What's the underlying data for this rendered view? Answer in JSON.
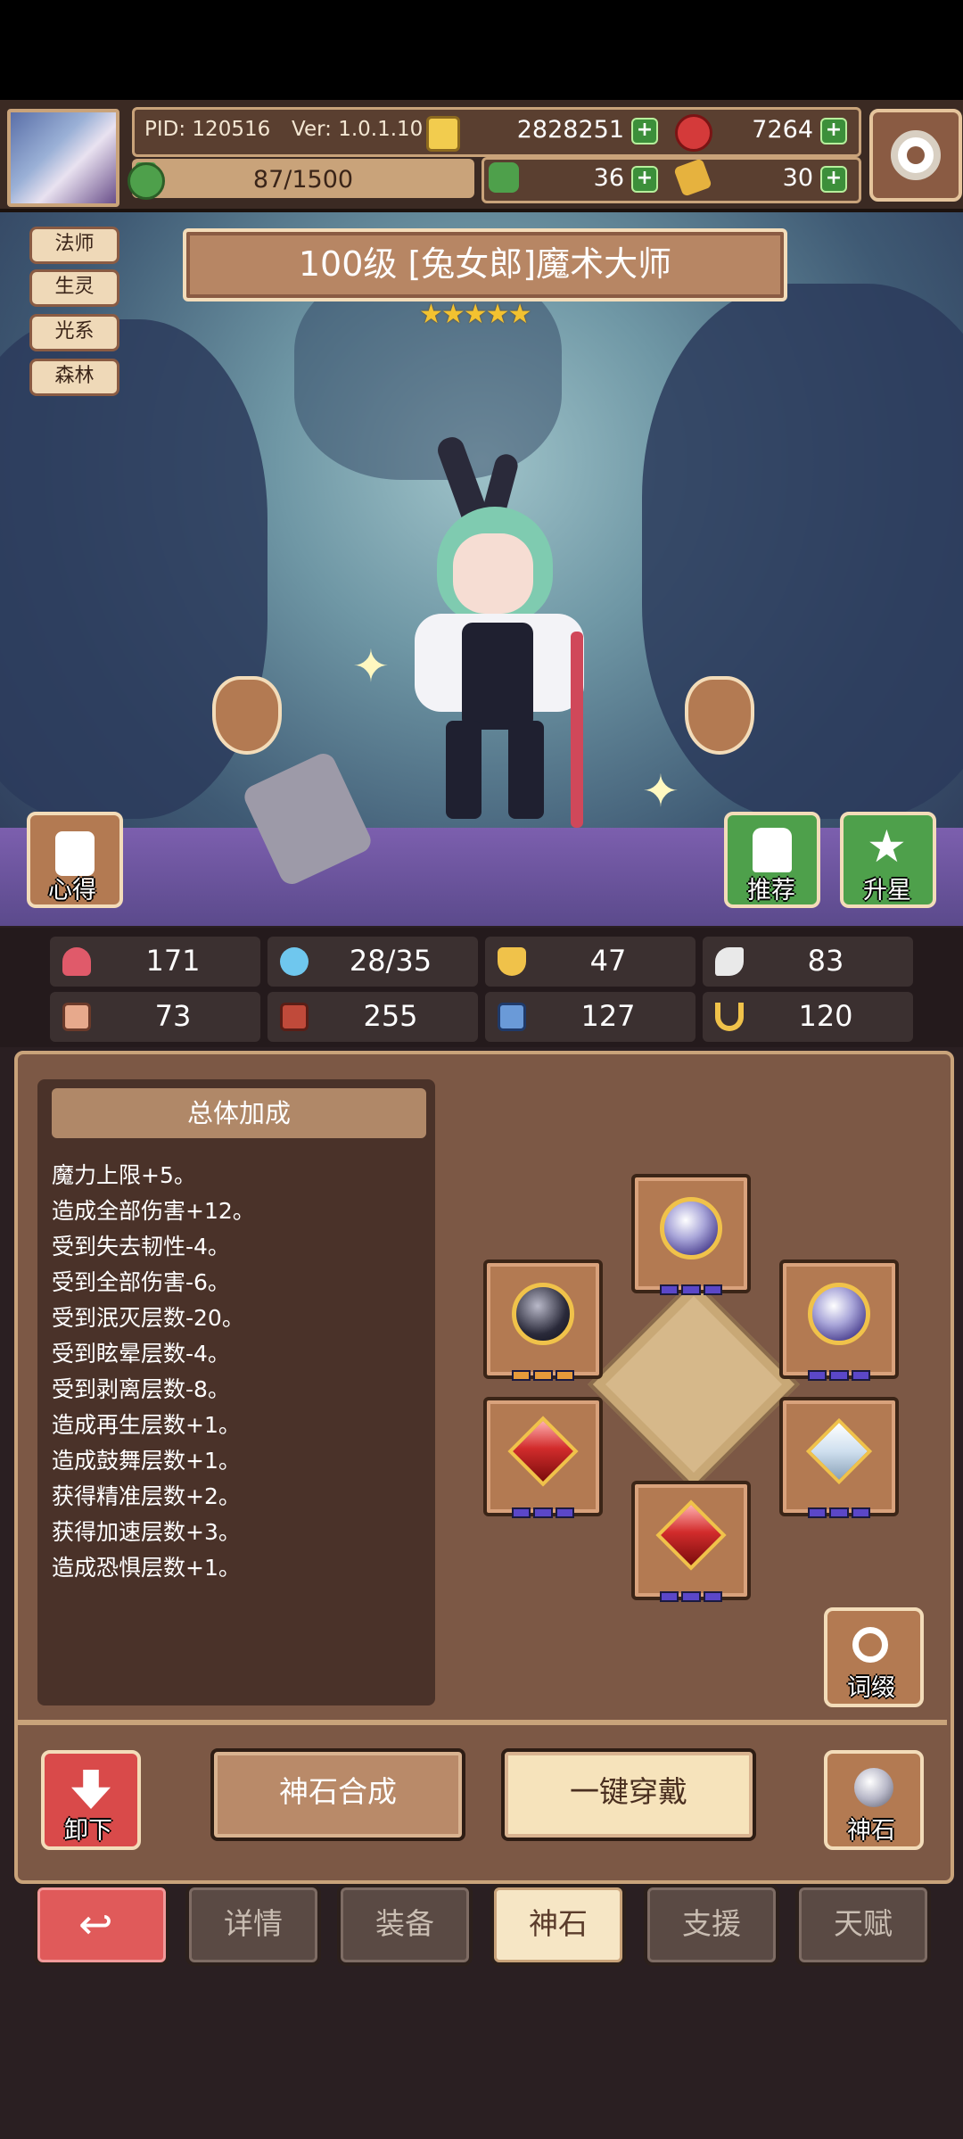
{
  "header": {
    "pid_label": "PID: 120516",
    "ver_label": "Ver: 1.0.1.10",
    "gold": "2828251",
    "ruby": "7264",
    "stamina": "87/1500",
    "clover": "36",
    "ticket": "30",
    "gear_icon": "gear-icon"
  },
  "tags": [
    "法师",
    "生灵",
    "光系",
    "森林"
  ],
  "character": {
    "title": "100级 [兔女郎]魔术大师",
    "stars": "★★★★★",
    "star_count": 5
  },
  "scene_buttons": {
    "notes": "心得",
    "recommend": "推荐",
    "star_up": "升星"
  },
  "stats": [
    {
      "icon": "heart-icon",
      "value": "171",
      "color": "#e05a6a"
    },
    {
      "icon": "mana-drop-icon",
      "value": "28/35",
      "color": "#6fc7ee"
    },
    {
      "icon": "shield-icon",
      "value": "47",
      "color": "#f0c24a"
    },
    {
      "icon": "wing-icon",
      "value": "83",
      "color": "#e9e9e9"
    },
    {
      "icon": "fist-icon",
      "value": "73",
      "color": "#e7a98c"
    },
    {
      "icon": "spellbook-icon",
      "value": "255",
      "color": "#c04a3a"
    },
    {
      "icon": "boot-icon",
      "value": "127",
      "color": "#6a9ad8"
    },
    {
      "icon": "horseshoe-icon",
      "value": "120",
      "color": "#f0c24a"
    }
  ],
  "bonus": {
    "title": "总体加成",
    "lines": [
      "魔力上限+5。",
      "造成全部伤害+12。",
      "受到失去韧性-4。",
      "受到全部伤害-6。",
      "受到泯灭层数-20。",
      "受到眩晕层数-4。",
      "受到剥离层数-8。",
      "造成再生层数+1。",
      "造成鼓舞层数+1。",
      "获得精准层数+2。",
      "获得加速层数+3。",
      "造成恐惧层数+1。"
    ]
  },
  "gem_slots": [
    {
      "name": "gem-slot-top",
      "gem": "purple-orb",
      "pips": "purple"
    },
    {
      "name": "gem-slot-upper-left",
      "gem": "black-orb",
      "pips": "orange"
    },
    {
      "name": "gem-slot-upper-right",
      "gem": "purple-orb",
      "pips": "purple"
    },
    {
      "name": "gem-slot-lower-left",
      "gem": "red-diamond",
      "pips": "purple"
    },
    {
      "name": "gem-slot-lower-right",
      "gem": "white-diamond",
      "pips": "purple"
    },
    {
      "name": "gem-slot-bottom",
      "gem": "red-diamond",
      "pips": "purple"
    }
  ],
  "actions": {
    "affix": "词缀",
    "unequip": "卸下",
    "synthesize": "神石合成",
    "equip_all": "一键穿戴",
    "godstone": "神石"
  },
  "tabs": [
    "详情",
    "装备",
    "神石",
    "支援",
    "天赋"
  ],
  "active_tab": "神石"
}
